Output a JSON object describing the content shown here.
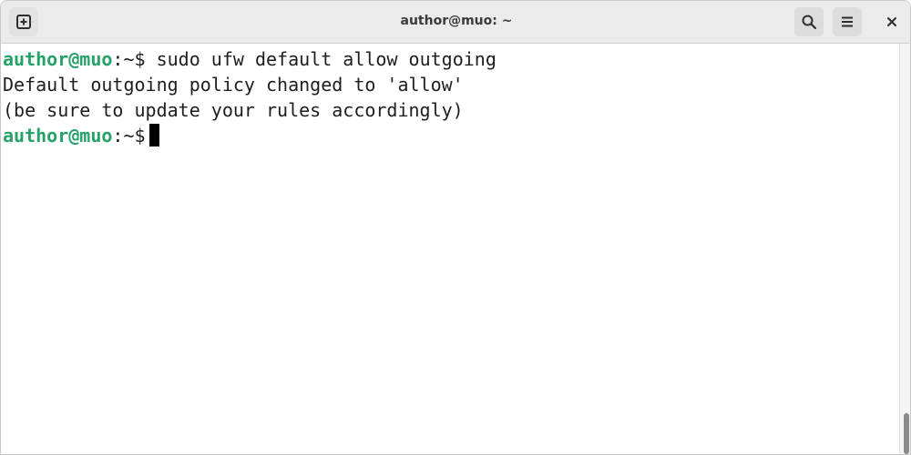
{
  "window": {
    "title": "author@muo: ~"
  },
  "toolbar": {
    "new_tab_icon": "new-tab-icon",
    "search_icon": "search-icon",
    "menu_icon": "hamburger-menu-icon",
    "close_label": "×"
  },
  "terminal": {
    "lines": [
      {
        "user": "author@muo",
        "path": ":~$",
        "command": " sudo ufw default allow outgoing"
      },
      {
        "text": "Default outgoing policy changed to 'allow'"
      },
      {
        "text": "(be sure to update your rules accordingly)"
      },
      {
        "user": "author@muo",
        "path": ":~$",
        "command": " "
      }
    ]
  },
  "colors": {
    "prompt_user": "#26a269",
    "text": "#1e1e1e",
    "cursor": "#000000",
    "titlebar": "#ebebeb"
  }
}
